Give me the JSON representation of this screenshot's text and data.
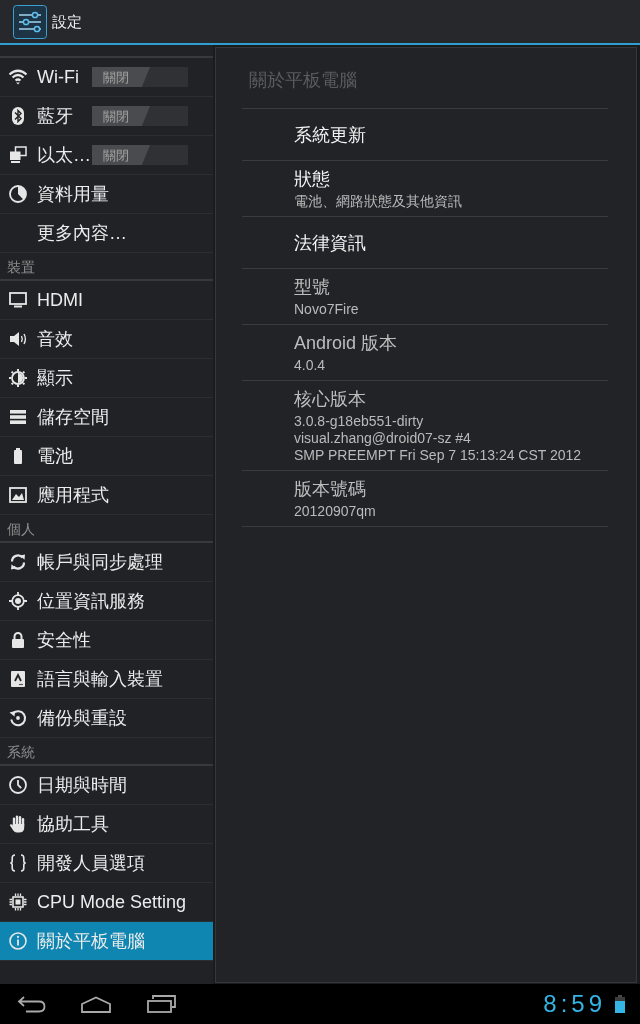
{
  "action_bar": {
    "title": "設定"
  },
  "sidebar": {
    "sections": [
      {
        "items": [
          {
            "label": "Wi-Fi",
            "kind": "toggle",
            "selected": false,
            "toggle": {
              "label": "關閉",
              "on": false
            }
          },
          {
            "label": "藍牙",
            "kind": "toggle",
            "selected": false,
            "toggle": {
              "label": "關閉",
              "on": false
            }
          },
          {
            "label": "以太…",
            "kind": "toggle",
            "selected": false,
            "toggle": {
              "label": "關閉",
              "on": false
            }
          },
          {
            "label": "資料用量",
            "kind": "plain",
            "selected": false
          },
          {
            "label": "更多內容…",
            "kind": "plain",
            "selected": false
          }
        ]
      },
      {
        "header": "裝置",
        "items": [
          {
            "label": "HDMI",
            "kind": "plain",
            "selected": false
          },
          {
            "label": "音效",
            "kind": "plain",
            "selected": false
          },
          {
            "label": "顯示",
            "kind": "plain",
            "selected": false
          },
          {
            "label": "儲存空間",
            "kind": "plain",
            "selected": false
          },
          {
            "label": "電池",
            "kind": "plain",
            "selected": false
          },
          {
            "label": "應用程式",
            "kind": "plain",
            "selected": false
          }
        ]
      },
      {
        "header": "個人",
        "items": [
          {
            "label": "帳戶與同步處理",
            "kind": "plain",
            "selected": false
          },
          {
            "label": "位置資訊服務",
            "kind": "plain",
            "selected": false
          },
          {
            "label": "安全性",
            "kind": "plain",
            "selected": false
          },
          {
            "label": "語言與輸入裝置",
            "kind": "plain",
            "selected": false
          },
          {
            "label": "備份與重設",
            "kind": "plain",
            "selected": false
          }
        ]
      },
      {
        "header": "系統",
        "items": [
          {
            "label": "日期與時間",
            "kind": "plain",
            "selected": false
          },
          {
            "label": "協助工具",
            "kind": "plain",
            "selected": false
          },
          {
            "label": "開發人員選項",
            "kind": "plain",
            "selected": false
          },
          {
            "label": "CPU Mode Setting",
            "kind": "plain",
            "selected": false
          },
          {
            "label": "關於平板電腦",
            "kind": "plain",
            "selected": true
          }
        ]
      }
    ]
  },
  "detail": {
    "title": "關於平板電腦",
    "items": [
      {
        "title": "系統更新",
        "disabled": false
      },
      {
        "title": "狀態",
        "summary": [
          "電池、網路狀態及其他資訊"
        ],
        "disabled": false
      },
      {
        "title": "法律資訊",
        "disabled": false
      },
      {
        "title": "型號",
        "summary": [
          "Novo7Fire"
        ],
        "disabled": true
      },
      {
        "title": "Android 版本",
        "summary": [
          "4.0.4"
        ],
        "disabled": true
      },
      {
        "title": "核心版本",
        "summary": [
          "3.0.8-g18eb551-dirty",
          "visual.zhang@droid07-sz #4",
          "SMP PREEMPT Fri Sep 7 15:13:24 CST 2012"
        ],
        "disabled": true
      },
      {
        "title": "版本號碼",
        "summary": [
          "20120907qm"
        ],
        "disabled": true
      }
    ]
  },
  "status_bar": {
    "clock": "8:59"
  }
}
